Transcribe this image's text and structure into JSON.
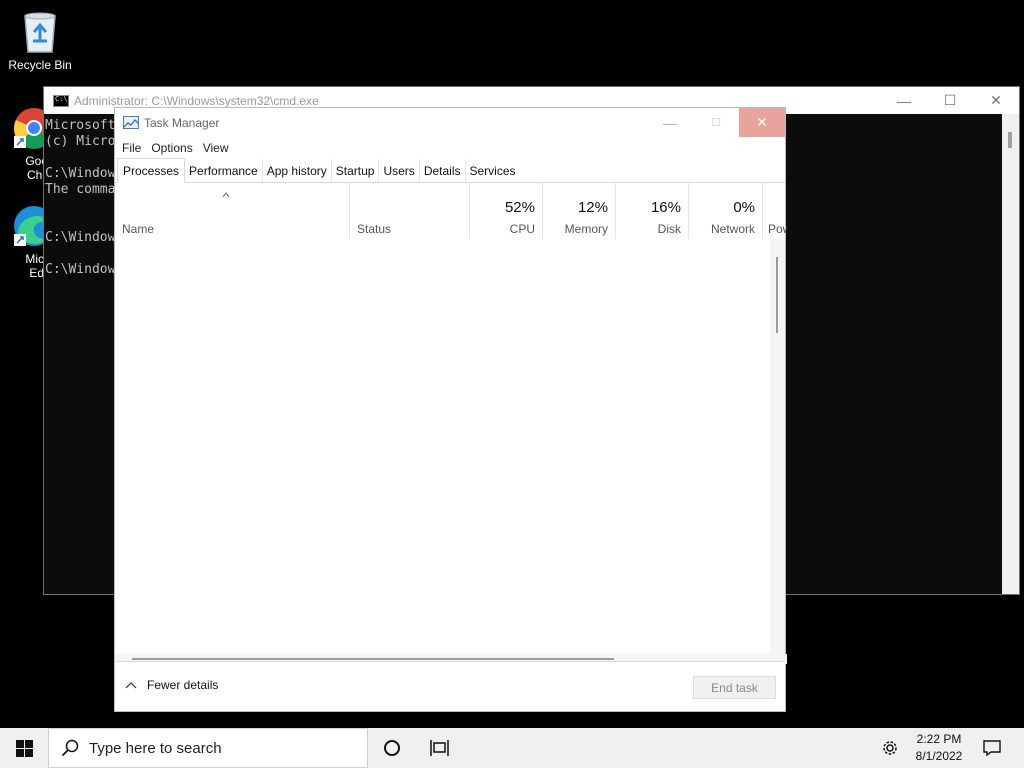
{
  "desktop": {
    "icons": [
      {
        "label": "Recycle Bin"
      },
      {
        "label": "Google Chrome",
        "label_visible": "Goog\nChro"
      },
      {
        "label": "Microsoft Edge",
        "label_visible": "Micro\nEdg"
      }
    ]
  },
  "cmd": {
    "title": "Administrator: C:\\Windows\\system32\\cmd.exe",
    "lines": [
      "Microsoft",
      "(c) Micro",
      "",
      "C:\\Window",
      "The comma",
      "",
      "",
      "C:\\Window",
      "",
      "C:\\Window"
    ]
  },
  "task_manager": {
    "title": "Task Manager",
    "menu": [
      "File",
      "Options",
      "View"
    ],
    "tabs": [
      "Processes",
      "Performance",
      "App history",
      "Startup",
      "Users",
      "Details",
      "Services"
    ],
    "active_tab": "Processes",
    "columns": {
      "name": "Name",
      "status": "Status",
      "cpu": {
        "pct": "52%",
        "label": "CPU"
      },
      "memory": {
        "pct": "12%",
        "label": "Memory"
      },
      "disk": {
        "pct": "16%",
        "label": "Disk"
      },
      "network": {
        "pct": "0%",
        "label": "Network"
      },
      "power": {
        "label": "Pow"
      }
    },
    "fewer_details": "Fewer details",
    "end_task": "End task"
  },
  "taskbar": {
    "search_placeholder": "Type here to search",
    "time": "2:22 PM",
    "date": "8/1/2022"
  },
  "colors": {
    "close_hover": "#e8a39c",
    "taskbar": "#f0f0f0",
    "console_bg": "#0c0c0c"
  }
}
